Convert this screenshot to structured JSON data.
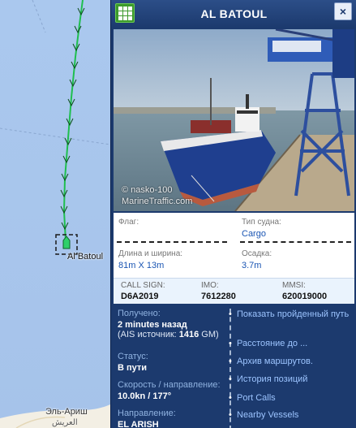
{
  "map": {
    "ship_label": "Al Batoul",
    "city_label": "Эль-Ариш",
    "city_label_ar": "العريش"
  },
  "panel": {
    "title": "AL BATOUL",
    "close_label": "×",
    "photo": {
      "credit_line1": "© nasko-100",
      "credit_line2": "MarineTraffic.com"
    },
    "details": {
      "flag_label": "Флаг:",
      "flag_value": "",
      "type_label": "Тип судна:",
      "type_value": "Cargo",
      "size_label": "Длина и ширина:",
      "size_value": "81m X 13m",
      "draught_label": "Осадка:",
      "draught_value": "3.7m"
    },
    "ids": {
      "callsign_label": "CALL SIGN:",
      "callsign_value": "D6A2019",
      "imo_label": "IMO:",
      "imo_value": "7612280",
      "mmsi_label": "MMSI:",
      "mmsi_value": "620019000"
    },
    "status": {
      "received_label": "Получено:",
      "received_value": "2 minutes назад",
      "ais_prefix": "(AIS источник: ",
      "ais_value": "1416",
      "ais_suffix": " GM)",
      "status_label": "Статус:",
      "status_value": "В пути",
      "speed_label": "Скорость / направление:",
      "speed_value": "10.0kn / 177°",
      "destination_label": "Направление:",
      "destination_value": "EL ARISH"
    },
    "links": [
      "Показать пройденный путь",
      "Расстояние до ...",
      "Архив маршрутов.",
      "История позиций",
      "Port Calls",
      "Nearby Vessels"
    ]
  },
  "colors": {
    "panel_bg": "#1c3a6e",
    "sea": "#a9c6ec",
    "track": "#22c05a",
    "link": "#9cc4ff"
  }
}
